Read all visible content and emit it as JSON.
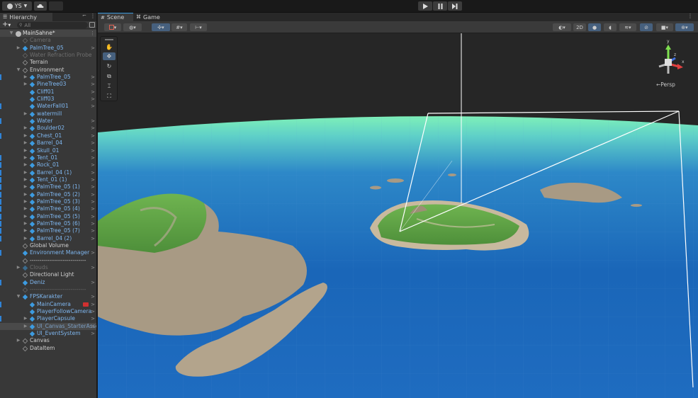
{
  "topbar": {
    "account": "YS",
    "account_icon": "person-icon",
    "cloud_icon": "cloud-icon",
    "play_icon": "play-icon",
    "pause_icon": "pause-icon",
    "step_icon": "step-icon"
  },
  "hierarchy": {
    "tab_label": "Hierarchy",
    "lock_icon": "lock-icon",
    "menu_icon": "kebab-icon",
    "add_label": "+",
    "search_placeholder": "All",
    "rows": [
      {
        "label": "MainSahne*",
        "depth": 0,
        "kind": "scene",
        "fold": "open",
        "more": "⋮"
      },
      {
        "label": "Camera",
        "depth": 1,
        "kind": "dim",
        "fold": "",
        "more": ""
      },
      {
        "label": "PalmTree_05",
        "depth": 1,
        "kind": "prefab",
        "fold": "closed",
        "more": ">"
      },
      {
        "label": "Water Refraction Probe",
        "depth": 1,
        "kind": "dim",
        "fold": "",
        "more": ""
      },
      {
        "label": "Terrain",
        "depth": 1,
        "kind": "plain",
        "fold": "",
        "more": ""
      },
      {
        "label": "Environment",
        "depth": 1,
        "kind": "plain",
        "fold": "open",
        "more": ""
      },
      {
        "label": "PalmTree_05",
        "depth": 2,
        "kind": "prefab",
        "fold": "closed",
        "more": ">",
        "ind": true
      },
      {
        "label": "PineTree03",
        "depth": 2,
        "kind": "prefab",
        "fold": "closed",
        "more": ">"
      },
      {
        "label": "Cliff01",
        "depth": 2,
        "kind": "prefab",
        "fold": "",
        "more": ">"
      },
      {
        "label": "Cliff03",
        "depth": 2,
        "kind": "prefab",
        "fold": "",
        "more": ">"
      },
      {
        "label": "WaterFall01",
        "depth": 2,
        "kind": "prefab",
        "fold": "",
        "more": ">",
        "ind": true
      },
      {
        "label": "watermill",
        "depth": 2,
        "kind": "prefab",
        "fold": "closed",
        "more": ""
      },
      {
        "label": "Water",
        "depth": 2,
        "kind": "prefab",
        "fold": "",
        "more": ">",
        "ind": true
      },
      {
        "label": "Boulder02",
        "depth": 2,
        "kind": "prefab",
        "fold": "closed",
        "more": ">"
      },
      {
        "label": "Chest_01",
        "depth": 2,
        "kind": "prefab",
        "fold": "closed",
        "more": ">",
        "ind": true
      },
      {
        "label": "Barrel_04",
        "depth": 2,
        "kind": "prefab",
        "fold": "closed",
        "more": ">"
      },
      {
        "label": "Skull_01",
        "depth": 2,
        "kind": "prefab",
        "fold": "closed",
        "more": ">"
      },
      {
        "label": "Tent_01",
        "depth": 2,
        "kind": "prefab",
        "fold": "closed",
        "more": ">",
        "ind": true
      },
      {
        "label": "Rock_01",
        "depth": 2,
        "kind": "prefab",
        "fold": "closed",
        "more": ">",
        "ind": true
      },
      {
        "label": "Barrel_04 (1)",
        "depth": 2,
        "kind": "prefab",
        "fold": "closed",
        "more": ">",
        "ind": true
      },
      {
        "label": "Tent_01 (1)",
        "depth": 2,
        "kind": "prefab",
        "fold": "closed",
        "more": ">",
        "ind": true
      },
      {
        "label": "PalmTree_05 (1)",
        "depth": 2,
        "kind": "prefab",
        "fold": "closed",
        "more": ">",
        "ind": true
      },
      {
        "label": "PalmTree_05 (2)",
        "depth": 2,
        "kind": "prefab",
        "fold": "closed",
        "more": ">",
        "ind": true
      },
      {
        "label": "PalmTree_05 (3)",
        "depth": 2,
        "kind": "prefab",
        "fold": "closed",
        "more": ">",
        "ind": true
      },
      {
        "label": "PalmTree_05 (4)",
        "depth": 2,
        "kind": "prefab",
        "fold": "closed",
        "more": ">",
        "ind": true
      },
      {
        "label": "PalmTree_05 (5)",
        "depth": 2,
        "kind": "prefab",
        "fold": "closed",
        "more": ">",
        "ind": true
      },
      {
        "label": "PalmTree_05 (6)",
        "depth": 2,
        "kind": "prefab",
        "fold": "closed",
        "more": ">",
        "ind": true
      },
      {
        "label": "PalmTree_05 (7)",
        "depth": 2,
        "kind": "prefab",
        "fold": "closed",
        "more": ">",
        "ind": true
      },
      {
        "label": "Barrel_04 (2)",
        "depth": 2,
        "kind": "prefab",
        "fold": "closed",
        "more": ">",
        "ind": true
      },
      {
        "label": "Global Volume",
        "depth": 1,
        "kind": "plain",
        "fold": "",
        "more": ""
      },
      {
        "label": "Environment Manager",
        "depth": 1,
        "kind": "prefab",
        "fold": "",
        "more": ">",
        "ind": true
      },
      {
        "label": "-----------------------------",
        "depth": 1,
        "kind": "plain",
        "fold": "",
        "more": ""
      },
      {
        "label": "Clouds",
        "depth": 1,
        "kind": "dimprefab",
        "fold": "closed",
        "more": ">"
      },
      {
        "label": "Directional Light",
        "depth": 1,
        "kind": "plain",
        "fold": "",
        "more": ""
      },
      {
        "label": "Deniz",
        "depth": 1,
        "kind": "prefab",
        "fold": "",
        "more": ">",
        "ind": true
      },
      {
        "label": "-----------------------------",
        "depth": 1,
        "kind": "dim",
        "fold": "",
        "more": ""
      },
      {
        "label": "FPSKarakter",
        "depth": 1,
        "kind": "prefab",
        "fold": "open",
        "more": ">"
      },
      {
        "label": "MainCamera",
        "depth": 2,
        "kind": "prefab",
        "fold": "",
        "more": ">",
        "ind": true,
        "badge": true
      },
      {
        "label": "PlayerFollowCamera",
        "depth": 2,
        "kind": "prefab",
        "fold": "",
        "more": ">"
      },
      {
        "label": "PlayerCapsule",
        "depth": 2,
        "kind": "prefab",
        "fold": "closed",
        "more": ">",
        "ind": true
      },
      {
        "label": "UI_Canvas_StarterAssetsInputs_Joysticks",
        "depth": 2,
        "kind": "selected",
        "fold": "closed",
        "more": ">"
      },
      {
        "label": "UI_EventSystem",
        "depth": 2,
        "kind": "prefab",
        "fold": "",
        "more": ">"
      },
      {
        "label": "Canvas",
        "depth": 1,
        "kind": "plain",
        "fold": "closed",
        "more": ""
      },
      {
        "label": "DataItem",
        "depth": 1,
        "kind": "plain",
        "fold": "",
        "more": ""
      }
    ]
  },
  "scene_tabs": [
    {
      "label": "Scene",
      "icon": "grid-icon"
    },
    {
      "label": "Game",
      "icon": "gamepad-icon"
    }
  ],
  "scene_toolbar": {
    "mode_2d": "2D"
  },
  "gizmo": {
    "axis_x": "x",
    "axis_y": "y",
    "axis_z": "z",
    "view_label": "←Persp"
  },
  "colors": {
    "accent": "#3d9be0",
    "prefab_text": "#7fb7f0",
    "selection": "#46607e",
    "sky": "#262626"
  }
}
